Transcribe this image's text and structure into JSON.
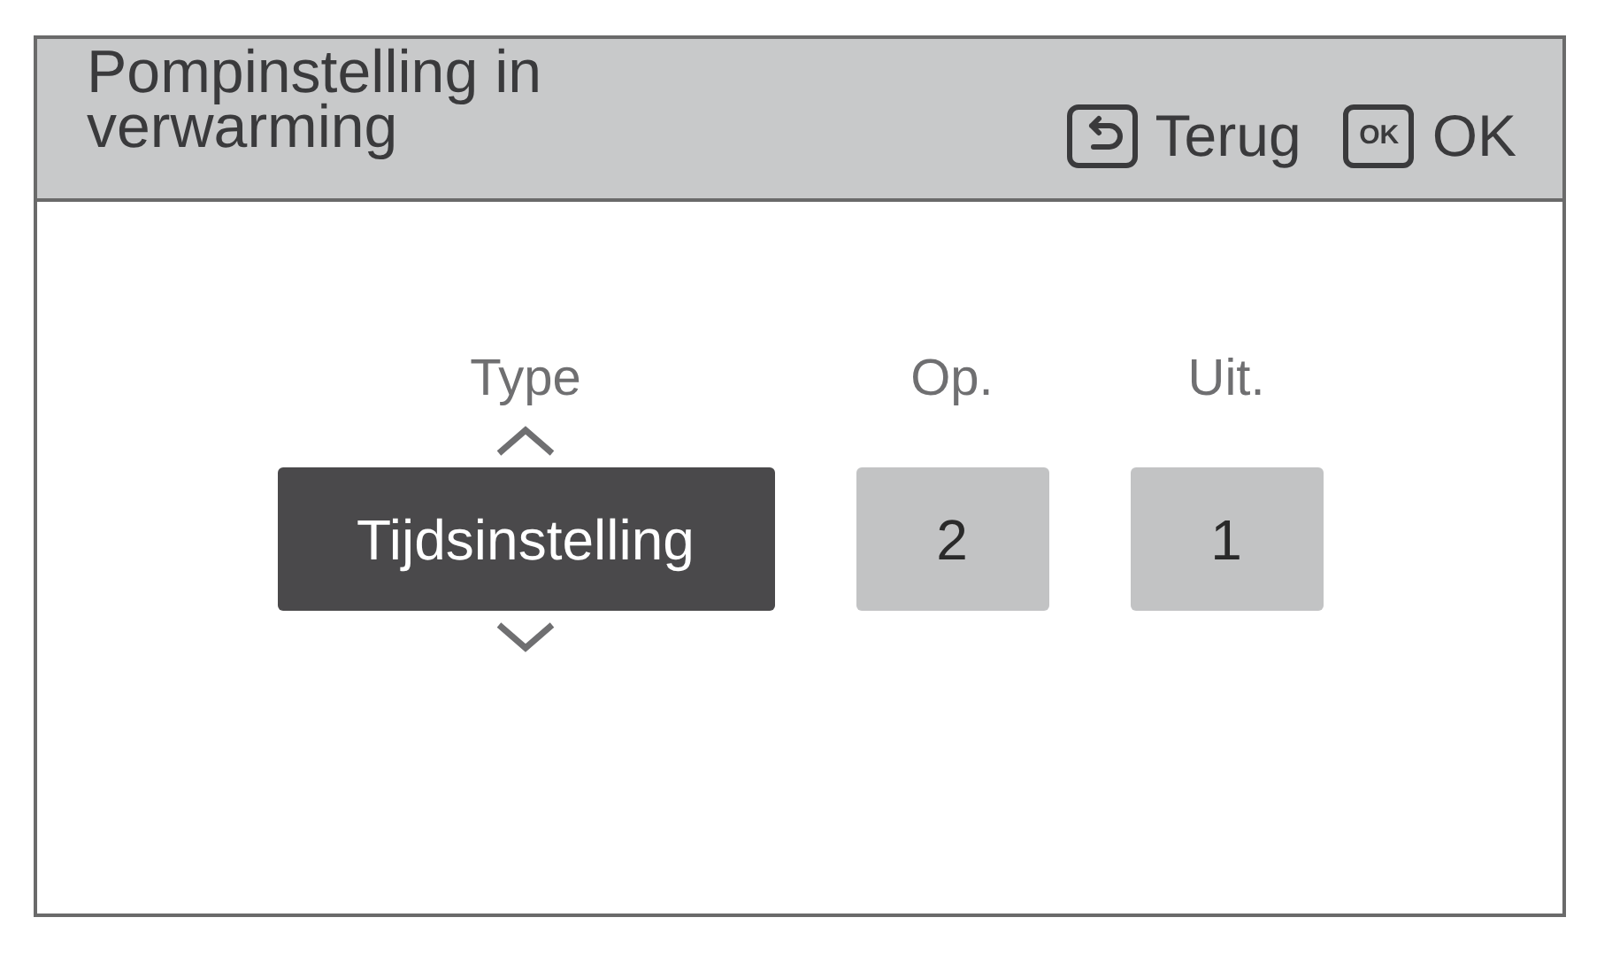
{
  "screen": {
    "title": "Pompinstelling in verwarming",
    "buttons": [
      {
        "kind": "back",
        "label": "Terug"
      },
      {
        "kind": "ok",
        "icon_text": "OK",
        "label": "OK"
      }
    ],
    "fields": [
      {
        "label": "Type",
        "value": "Tijdsinstelling",
        "selected": true
      },
      {
        "label": "Op.",
        "value": "2",
        "selected": false
      },
      {
        "label": "Uit.",
        "value": "1",
        "selected": false
      }
    ]
  }
}
